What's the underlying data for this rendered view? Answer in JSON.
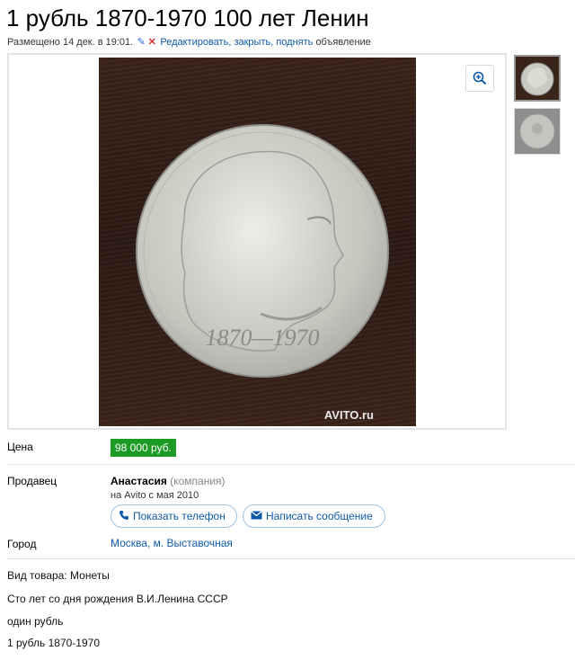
{
  "listing": {
    "title": "1 рубль 1870-1970 100 лет Ленин",
    "posted": "Размещено 14 дек. в 19:01.",
    "edit_link": "Редактировать, закрыть, поднять",
    "edit_suffix": "объявление"
  },
  "photo": {
    "coin_years": "1870—1970",
    "watermark": "AVITO.ru",
    "zoom_icon": "zoom-in-icon"
  },
  "details": {
    "price_label": "Цена",
    "price": "98 000 руб.",
    "seller_label": "Продавец",
    "seller_name": "Анастасия",
    "seller_type": "(компания)",
    "seller_since": "на Avito с мая 2010",
    "show_phone": "Показать телефон",
    "write_message": "Написать сообщение",
    "city_label": "Город",
    "city": "Москва, м. Выставочная"
  },
  "description": [
    "Вид товара: Монеты",
    "Сто лет со дня рождения В.И.Ленина СССР",
    "один рубль",
    "1 рубль 1870-1970"
  ],
  "colors": {
    "price_bg": "#1b9a24",
    "link": "#0e5aa8"
  }
}
